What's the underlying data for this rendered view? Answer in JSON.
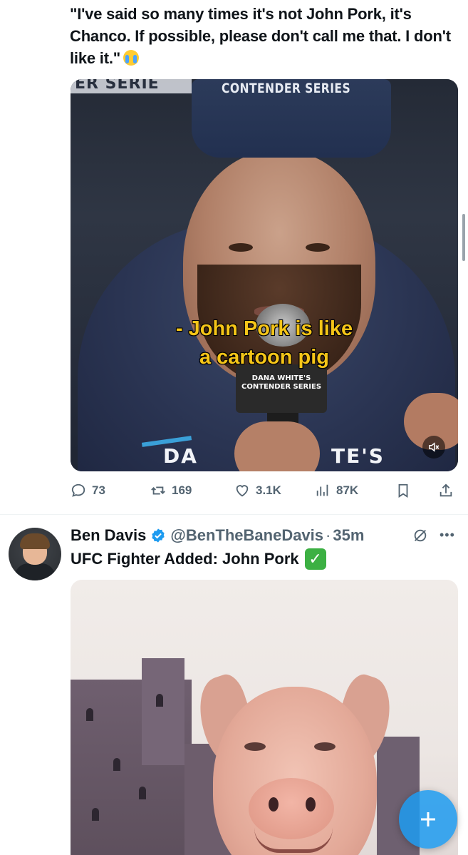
{
  "tweet1": {
    "text": "\"I've said so many times it's not John Pork, it's Chanco. If possible, please don't call me that. I don't like it.\"",
    "emoji": "loudly-crying-face",
    "media": {
      "banner_text": "ER SERIE",
      "cap_text": "CONTENDER SERIES",
      "caption_line1": "- John Pork is like",
      "caption_line2": "a cartoon pig",
      "mic_flag_line1": "DANA WHITE'S",
      "mic_flag_line2": "CONTENDER SERIES",
      "bottom_logo_left": "DA",
      "bottom_logo_right": "TE'S",
      "mute_icon": "volume-muted-icon"
    },
    "actions": {
      "replies": "73",
      "reposts": "169",
      "likes": "3.1K",
      "views": "87K"
    }
  },
  "tweet2": {
    "name": "Ben Davis",
    "verified": true,
    "handle": "@BenTheBaneDavis",
    "separator": "·",
    "time": "35m",
    "text": "UFC Fighter Added: John Pork",
    "check_emoji": "✓"
  },
  "fab": {
    "icon": "compose-plus-icon"
  },
  "colors": {
    "text_primary": "#0f1419",
    "text_secondary": "#536471",
    "accent": "#1d9bf0",
    "caption_yellow": "#f5c518"
  }
}
